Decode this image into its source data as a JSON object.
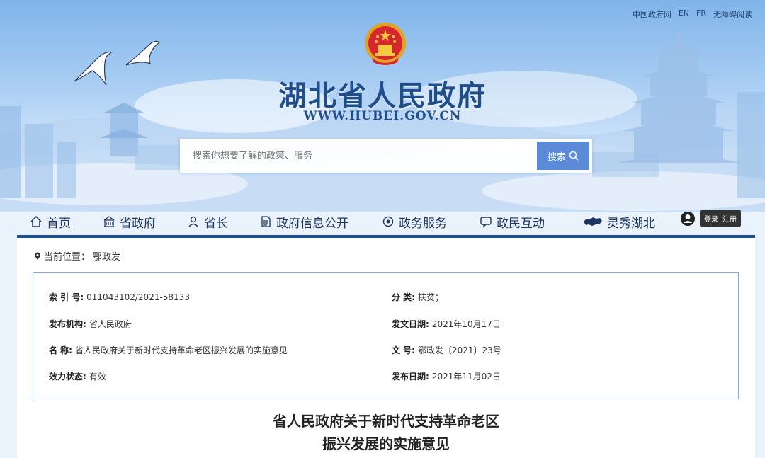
{
  "top_links": [
    "中国政府网",
    "EN",
    "FR",
    "无障碍阅读"
  ],
  "site": {
    "title": "湖北省人民政府",
    "url": "WWW.HUBEI.GOV.CN"
  },
  "search": {
    "placeholder": "搜索你想要了解的政策、服务",
    "button": "搜索"
  },
  "nav": [
    {
      "label": "首页",
      "icon": "home-icon"
    },
    {
      "label": "省政府",
      "icon": "building-icon"
    },
    {
      "label": "省长",
      "icon": "user-icon"
    },
    {
      "label": "政府信息公开",
      "icon": "document-icon"
    },
    {
      "label": "政务服务",
      "icon": "service-icon"
    },
    {
      "label": "政民互动",
      "icon": "chat-icon"
    },
    {
      "label": "灵秀湖北",
      "icon": "hubei-map-icon"
    }
  ],
  "login": {
    "login": "登录",
    "register": "注册"
  },
  "breadcrumb": {
    "label": "当前位置：",
    "value": "鄂政发"
  },
  "info": {
    "index_label": "索 引 号:",
    "index_value": "011043102/2021-58133",
    "category_label": "分 类:",
    "category_value": "扶贫；",
    "publisher_label": "发布机构:",
    "publisher_value": "省人民政府",
    "issue_date_label": "发文日期:",
    "issue_date_value": "2021年10月17日",
    "name_label": "名 称:",
    "name_value": "省人民政府关于新时代支持革命老区振兴发展的实施意见",
    "docno_label": "文 号:",
    "docno_value": "鄂政发〔2021〕23号",
    "status_label": "效力状态:",
    "status_value": "有效",
    "publish_date_label": "发布日期:",
    "publish_date_value": "2021年11月02日"
  },
  "doc_title": {
    "line1": "省人民政府关于新时代支持革命老区",
    "line2": "振兴发展的实施意见"
  },
  "colors": {
    "brand": "#1e4f8c",
    "search_button": "#5b8ad9",
    "box_border": "#8aa7d6"
  }
}
